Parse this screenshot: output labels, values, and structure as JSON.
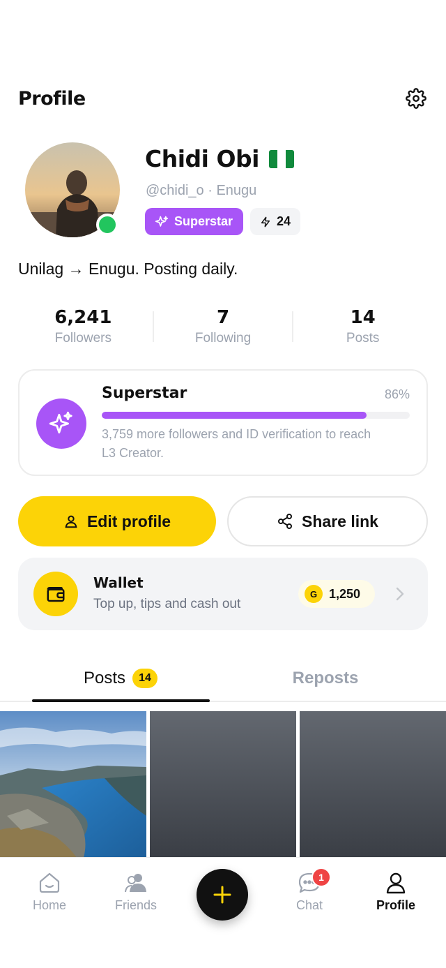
{
  "header": {
    "title": "Profile"
  },
  "profile": {
    "name": "Chidi Obi",
    "flag": "nigeria-flag",
    "handle": "@chidi_o · Enugu",
    "online": true,
    "badge_label": "Superstar",
    "streak_count": "24",
    "bio": "Unilag → Enugu. Posting daily."
  },
  "stats": [
    {
      "value": "6,241",
      "label": "Followers"
    },
    {
      "value": "7",
      "label": "Following"
    },
    {
      "value": "14",
      "label": "Posts"
    }
  ],
  "level": {
    "title": "Superstar",
    "percent_label": "86%",
    "progress_percent": 86,
    "description": "3,759 more followers and ID verification to reach L3 Creator."
  },
  "buttons": {
    "edit_profile": "Edit profile",
    "share_link": "Share link"
  },
  "wallet": {
    "title": "Wallet",
    "subtitle": "Top up, tips and cash out",
    "coin_symbol": "G",
    "balance": "1,250"
  },
  "tabs": [
    {
      "label": "Posts",
      "count": "14",
      "active": true
    },
    {
      "label": "Reposts",
      "active": false
    }
  ],
  "nav": {
    "home": "Home",
    "friends": "Friends",
    "chat": "Chat",
    "chat_badge": "1",
    "profile": "Profile"
  },
  "colors": {
    "accent_yellow": "#fcd307",
    "accent_purple": "#a855f7",
    "online_green": "#22c55e",
    "badge_red": "#ef4444"
  },
  "icons": [
    "gear-icon",
    "sparkle-icon",
    "bolt-icon",
    "user-icon",
    "share-icon",
    "wallet-icon",
    "chevron-right-icon",
    "home-icon",
    "friends-icon",
    "plus-icon",
    "chat-icon",
    "profile-icon"
  ]
}
